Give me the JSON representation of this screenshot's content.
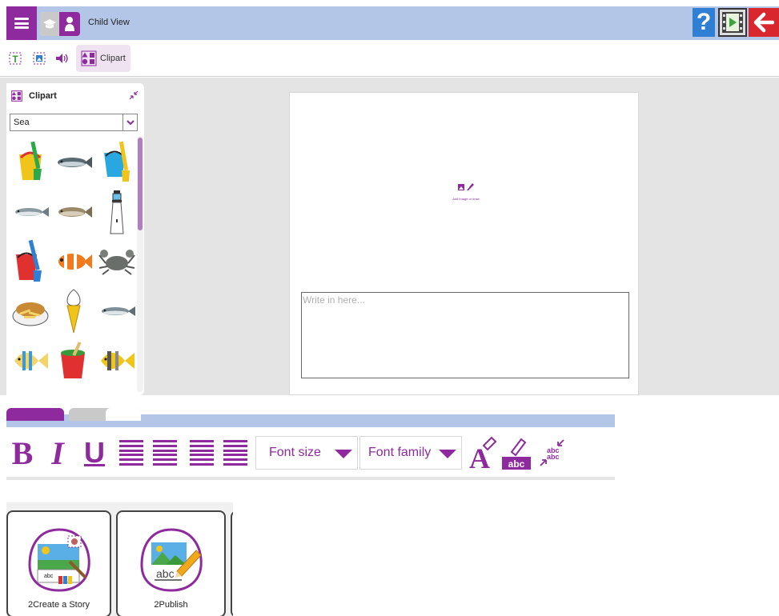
{
  "header": {
    "view_label": "Child View",
    "help_label": "?"
  },
  "toolbar": {
    "clipart_label": "Clipart"
  },
  "clipart_panel": {
    "title": "Clipart",
    "category": "Sea",
    "items": [
      "bucket-spade-icon",
      "fish-icon",
      "bucket-spade-icon",
      "fish-icon",
      "fish-icon",
      "lighthouse-icon",
      "bucket-spade-icon",
      "clownfish-icon",
      "crab-icon",
      "fish-and-chips-icon",
      "ice-cream-icon",
      "fish-icon",
      "tropical-fish-icon",
      "sandcastle-bucket-icon",
      "tropical-fish-icon"
    ]
  },
  "page": {
    "image_placeholder": "Add image or draw",
    "text_placeholder": "Write in here..."
  },
  "formatbar": {
    "bold": "B",
    "italic": "I",
    "underline": "U",
    "font_size": "Font size",
    "font_family": "Font family"
  },
  "launcher": {
    "apps": [
      {
        "name": "2Create a Story"
      },
      {
        "name": "2Publish"
      }
    ]
  },
  "colors": {
    "accent": "#8e2a9e",
    "topbar": "#b4c6e7",
    "help": "#2f7fd4",
    "back": "#d9272e"
  }
}
